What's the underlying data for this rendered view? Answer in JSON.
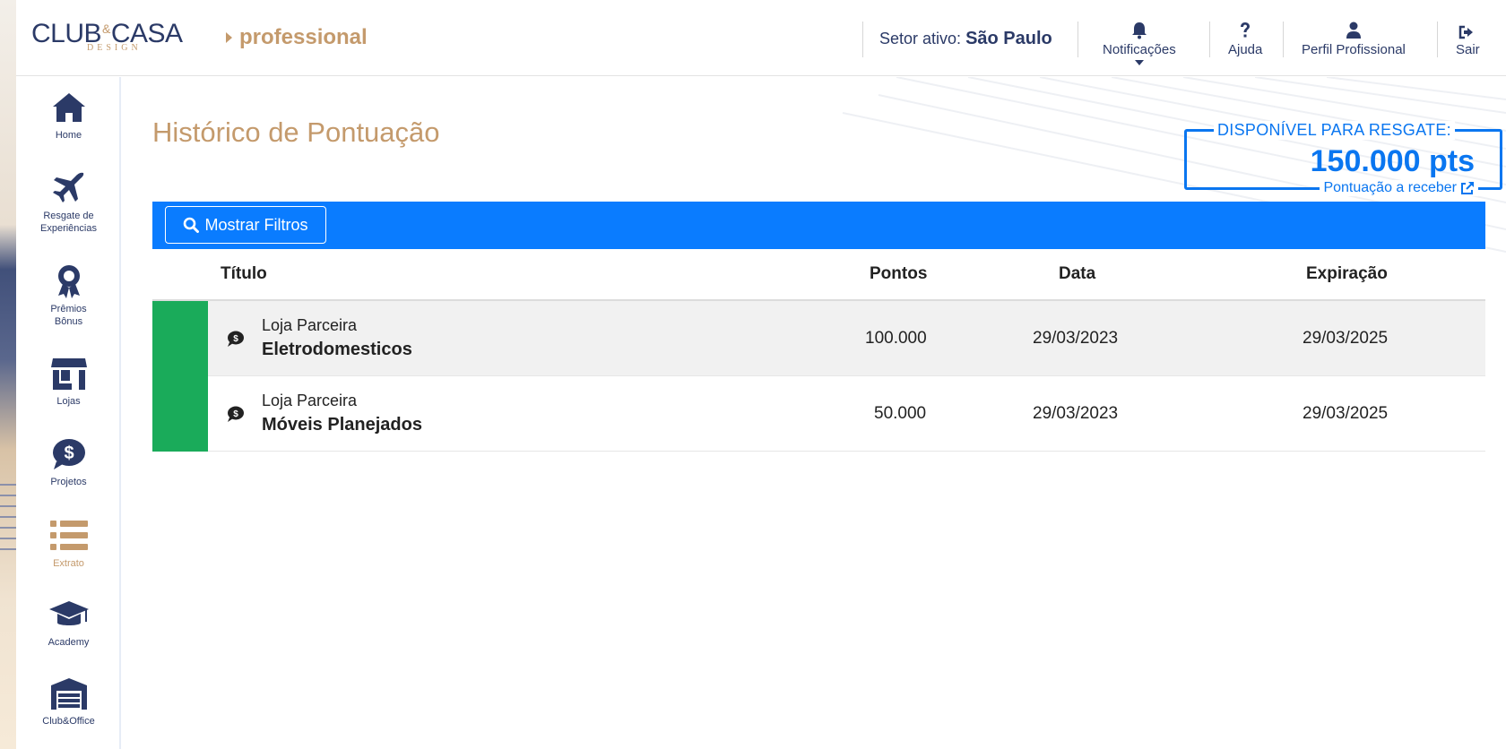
{
  "colors": {
    "brand_navy": "#2b3a67",
    "brand_gold": "#c49a6c",
    "accent_blue": "#0a7cff",
    "credit_green": "#1aab5a"
  },
  "header": {
    "logo_text": "CLUB&CASA",
    "logo_sub": "DESIGN",
    "product_label": "professional",
    "sector_label": "Setor ativo:",
    "sector_value": "São Paulo",
    "nav": [
      {
        "label": "Notificações",
        "icon": "bell-icon"
      },
      {
        "label": "Ajuda",
        "icon": "question-icon"
      },
      {
        "label": "Perfil Profissional",
        "icon": "user-icon"
      },
      {
        "label": "Sair",
        "icon": "sign-out-icon"
      }
    ]
  },
  "sidebar": {
    "items": [
      {
        "label": "Home",
        "icon": "home-icon"
      },
      {
        "label": "Resgate de Experiências",
        "icon": "airplane-icon"
      },
      {
        "label": "Prêmios Bônus",
        "icon": "award-icon"
      },
      {
        "label": "Lojas",
        "icon": "store-icon"
      },
      {
        "label": "Projetos",
        "icon": "dollar-bubble-icon"
      },
      {
        "label": "Extrato",
        "icon": "list-icon",
        "active": true
      },
      {
        "label": "Academy",
        "icon": "graduation-cap-icon"
      },
      {
        "label": "Club&Office",
        "icon": "warehouse-icon"
      }
    ]
  },
  "main": {
    "title": "Histórico de Pontuação",
    "available": {
      "label": "DISPONÍVEL PARA RESGATE:",
      "value": "150.000 pts",
      "link": "Pontuação a receber"
    },
    "filter_button": "Mostrar Filtros",
    "table": {
      "headers": {
        "title": "Título",
        "points": "Pontos",
        "date": "Data",
        "expiration": "Expiração"
      },
      "rows": [
        {
          "store": "Loja Parceira",
          "name": "Eletrodomesticos",
          "points": "100.000",
          "date": "29/03/2023",
          "expiration": "29/03/2025"
        },
        {
          "store": "Loja Parceira",
          "name": "Móveis Planejados",
          "points": "50.000",
          "date": "29/03/2023",
          "expiration": "29/03/2025"
        }
      ]
    }
  }
}
